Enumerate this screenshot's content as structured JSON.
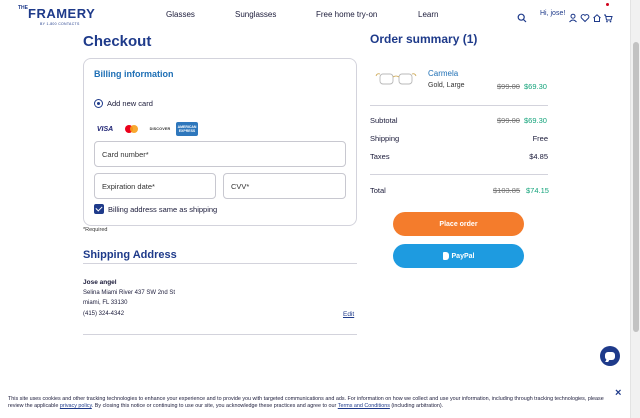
{
  "header": {
    "logo": {
      "the": "THE",
      "word": "FRAMERY",
      "sub": "BY 1-800 CONTACTS"
    },
    "nav": [
      "Glasses",
      "Sunglasses",
      "Free home try-on",
      "Learn"
    ],
    "greeting": "Hi, jose!",
    "icons": [
      "search-icon",
      "user-icon",
      "heart-icon",
      "home-icon",
      "cart-icon"
    ]
  },
  "checkout": {
    "title": "Checkout",
    "billing": {
      "title": "Billing information",
      "radio_label": "Add new card",
      "card_brands": {
        "visa": "VISA",
        "discover": "DISCOVER",
        "amex_top": "AMERICAN",
        "amex_bottom": "EXPRESS"
      },
      "card_number_label": "Card number*",
      "expiration_label": "Expiration date*",
      "cvv_label": "CVV*",
      "same_as_shipping_label": "Billing address same as shipping",
      "same_as_shipping_checked": true
    },
    "required_note": "*Required",
    "shipping": {
      "title": "Shipping Address",
      "name": "Jose angel",
      "lines": [
        "Selina Miami River 437 SW 2nd St",
        "miami, FL 33130",
        "(415) 324-4342"
      ],
      "edit_label": "Edit"
    }
  },
  "summary": {
    "title": "Order summary (1)",
    "item": {
      "name": "Carmela",
      "variant": "Gold, Large",
      "old_price": "$99.00",
      "new_price": "$69.30"
    },
    "subtotal": {
      "label": "Subtotal",
      "old": "$99.00",
      "new": "$69.30"
    },
    "shipping": {
      "label": "Shipping",
      "value": "Free"
    },
    "taxes": {
      "label": "Taxes",
      "value": "$4.85"
    },
    "total": {
      "label": "Total",
      "old": "$103.85",
      "new": "$74.15"
    },
    "place_order_label": "Place order",
    "paypal_label": "PayPal"
  },
  "cookie": {
    "text_1": "This site uses cookies and other tracking technologies to enhance your experience and to provide you with targeted communications and ads. For information on how we collect and use your information, including through tracking technologies, please review the applicable",
    "privacy_link": "privacy policy",
    "text_2": ". By closing this notice or continuing to use our site, you acknowledge these practices and agree to our",
    "terms_link": "Terms and Conditions",
    "text_3": "(including arbitration).",
    "close": "×"
  },
  "colors": {
    "brand_navy": "#1e3a8a",
    "link_blue": "#1e6fb5",
    "sale_green": "#12a37a",
    "place_order_orange": "#f47c2c",
    "paypal_blue": "#1e9be0"
  }
}
